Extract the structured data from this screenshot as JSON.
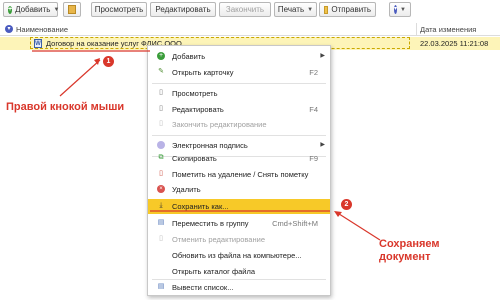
{
  "toolbar": {
    "add_label": "Добавить",
    "view_label": "Просмотреть",
    "edit_label": "Редактировать",
    "close_label": "Закончить",
    "print_label": "Печать",
    "send_label": "Отправить"
  },
  "table": {
    "col_name": "Наименование",
    "col_date": "Дата изменения",
    "row": {
      "icon_letter": "W",
      "name": "Договор на оказание услуг ФЛИС ООО",
      "date": "22.03.2025 11:21:08"
    }
  },
  "menu": {
    "add": "Добавить",
    "open_card": "Открыть карточку",
    "open_card_sc": "F2",
    "view": "Просмотреть",
    "edit": "Редактировать",
    "edit_sc": "F4",
    "finish_edit": "Закончить редактирование",
    "esign": "Электронная подпись",
    "copy": "Скопировать",
    "copy_sc": "F9",
    "mark_delete": "Пометить на удаление / Снять пометку",
    "delete": "Удалить",
    "save_as": "Сохранить как...",
    "move_group": "Переместить в группу",
    "move_group_sc": "Cmd+Shift+M",
    "cancel_edit": "Отменить редактирование",
    "update_from_file": "Обновить из файла на компьютере...",
    "open_folder": "Открыть каталог файла",
    "output_list": "Вывести список..."
  },
  "annotations": {
    "right_click": "Правой кнокой мыши",
    "save_doc_line1": "Сохраняем",
    "save_doc_line2": "документ",
    "badge1": "1",
    "badge2": "2"
  },
  "colors": {
    "accent": "#f7c928",
    "annotation": "#d9372b",
    "row_highlight": "#fdf4b8"
  }
}
